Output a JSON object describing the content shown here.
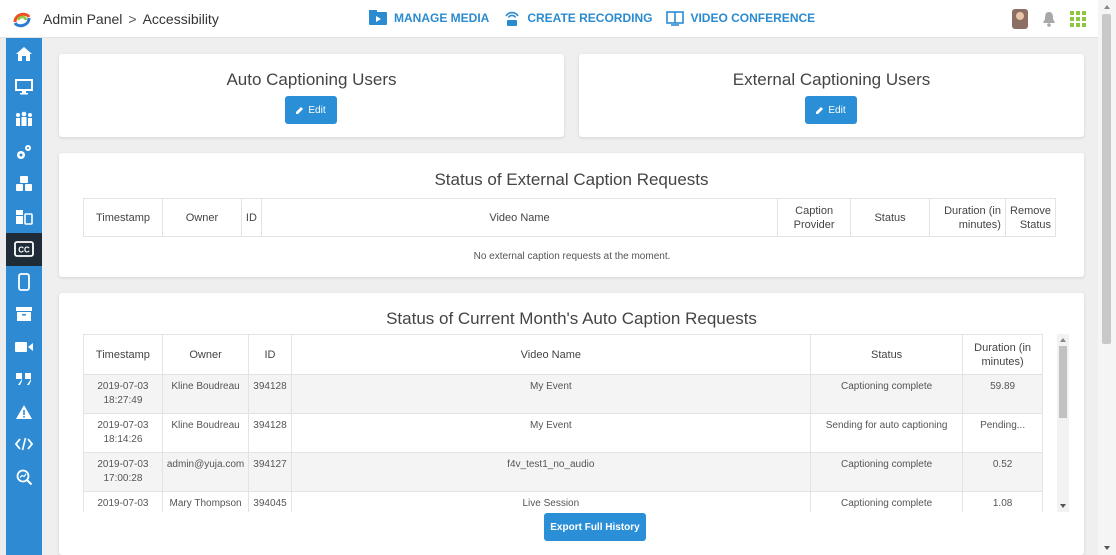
{
  "header": {
    "breadcrumb": [
      "Admin Panel",
      "Accessibility"
    ],
    "breadcrumb_separator": ">",
    "nav": [
      {
        "label": "MANAGE MEDIA",
        "icon": "media-library-icon"
      },
      {
        "label": "CREATE RECORDING",
        "icon": "broadcast-icon"
      },
      {
        "label": "VIDEO CONFERENCE",
        "icon": "book-open-icon"
      }
    ]
  },
  "sidebar": {
    "items": [
      {
        "icon": "home-icon"
      },
      {
        "icon": "monitor-icon"
      },
      {
        "icon": "users-group-icon"
      },
      {
        "icon": "gears-icon"
      },
      {
        "icon": "cubes-icon"
      },
      {
        "icon": "media-devices-icon"
      },
      {
        "icon": "closed-caption-icon",
        "active": true
      },
      {
        "icon": "mobile-icon"
      },
      {
        "icon": "archive-icon"
      },
      {
        "icon": "video-camera-icon"
      },
      {
        "icon": "quote-icon"
      },
      {
        "icon": "warning-icon"
      },
      {
        "icon": "code-icon"
      },
      {
        "icon": "search-analytics-icon"
      }
    ]
  },
  "auto_captioning": {
    "title": "Auto Captioning Users",
    "edit_label": "Edit"
  },
  "external_captioning": {
    "title": "External Captioning Users",
    "edit_label": "Edit"
  },
  "external_requests": {
    "title": "Status of External Caption Requests",
    "columns": [
      "Timestamp",
      "Owner",
      "ID",
      "Video Name",
      "Caption Provider",
      "Status",
      "Duration (in minutes)",
      "Remove Status"
    ],
    "empty_message": "No external caption requests at the moment."
  },
  "auto_requests": {
    "title": "Status of Current Month's Auto Caption Requests",
    "columns": [
      "Timestamp",
      "Owner",
      "ID",
      "Video Name",
      "Status",
      "Duration (in minutes)"
    ],
    "rows": [
      {
        "timestamp": "2019-07-03 18:27:49",
        "owner": "Kline Boudreau",
        "id": "394128",
        "video": "My Event",
        "status": "Captioning complete",
        "duration": "59.89"
      },
      {
        "timestamp": "2019-07-03 18:14:26",
        "owner": "Kline Boudreau",
        "id": "394128",
        "video": "My Event",
        "status": "Sending for auto captioning",
        "duration": "Pending..."
      },
      {
        "timestamp": "2019-07-03 17:00:28",
        "owner": "admin@yuja.com",
        "id": "394127",
        "video": "f4v_test1_no_audio",
        "status": "Captioning complete",
        "duration": "0.52"
      },
      {
        "timestamp": "2019-07-03",
        "owner": "Mary Thompson",
        "id": "394045",
        "video": "Live Session",
        "status": "Captioning complete",
        "duration": "1.08"
      }
    ],
    "export_label": "Export Full History"
  },
  "colors": {
    "accent": "#2e8bd3",
    "active_nav": "#1f2b36",
    "button": "#2b8fd8"
  }
}
